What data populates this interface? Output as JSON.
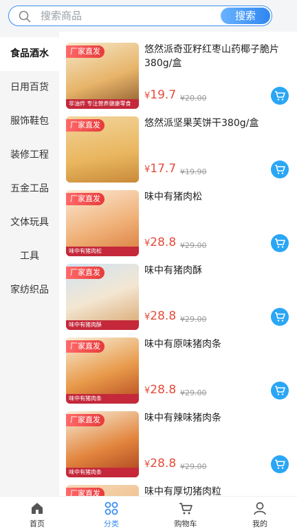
{
  "search": {
    "placeholder": "搜索商品",
    "button_label": "搜索"
  },
  "sidebar": {
    "items": [
      {
        "label": "食品酒水",
        "active": true
      },
      {
        "label": "日用百货",
        "active": false
      },
      {
        "label": "服饰鞋包",
        "active": false
      },
      {
        "label": "装修工程",
        "active": false
      },
      {
        "label": "五金工品",
        "active": false
      },
      {
        "label": "文体玩具",
        "active": false
      },
      {
        "label": "工具",
        "active": false
      },
      {
        "label": "家纺织品",
        "active": false
      }
    ]
  },
  "products": [
    {
      "badge": "厂家直发",
      "title": "悠然派奇亚籽红枣山药椰子脆片380g/盒",
      "currency": "¥",
      "price": "19.7",
      "original_price": "¥20.00",
      "caption": "非油炸 专注营养健康零食"
    },
    {
      "badge": "厂家直发",
      "title": "悠然派坚果芙饼干380g/盒",
      "currency": "¥",
      "price": "17.7",
      "original_price": "¥19.90",
      "caption": ""
    },
    {
      "badge": "厂家直发",
      "title": "味中有猪肉松",
      "currency": "¥",
      "price": "28.8",
      "original_price": "¥29.00",
      "caption": "味中有猪肉松"
    },
    {
      "badge": "厂家直发",
      "title": "味中有猪肉酥",
      "currency": "¥",
      "price": "28.8",
      "original_price": "¥29.00",
      "caption": "味中有猪肉酥"
    },
    {
      "badge": "厂家直发",
      "title": "味中有原味猪肉条",
      "currency": "¥",
      "price": "28.8",
      "original_price": "¥29.00",
      "caption": "味中有猪肉条"
    },
    {
      "badge": "厂家直发",
      "title": "味中有辣味猪肉条",
      "currency": "¥",
      "price": "28.8",
      "original_price": "¥29.00",
      "caption": "味中有猪肉条"
    },
    {
      "badge": "厂家直发",
      "title": "味中有厚切猪肉粒",
      "currency": "¥",
      "price": "",
      "original_price": "",
      "caption": ""
    }
  ],
  "tabbar": {
    "tabs": [
      {
        "label": "首页",
        "icon": "home-icon",
        "active": false
      },
      {
        "label": "分类",
        "icon": "category-icon",
        "active": true
      },
      {
        "label": "购物车",
        "icon": "cart-icon",
        "active": false
      },
      {
        "label": "我的",
        "icon": "user-icon",
        "active": false
      }
    ]
  },
  "colors": {
    "accent": "#3b8df2",
    "price": "#e34b3a",
    "cart_button": "#2aa6f5",
    "badge": "#e73a3a"
  }
}
